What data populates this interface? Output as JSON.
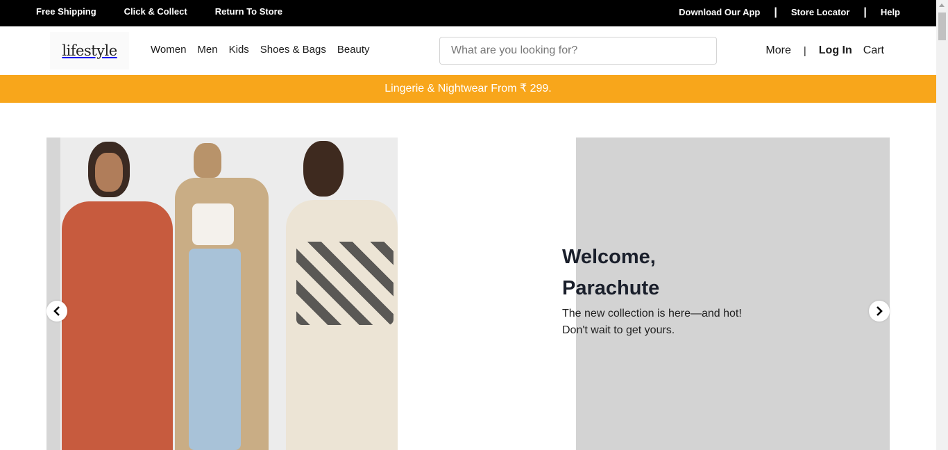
{
  "topbar": {
    "left_links": [
      "Free Shipping",
      "Click & Collect",
      "Return To Store"
    ],
    "download_app": "Download Our App",
    "separator": "|",
    "store_locator": "Store Locator",
    "help": "Help"
  },
  "header": {
    "logo_text": "lifestyle",
    "nav": [
      "Women",
      "Men",
      "Kids",
      "Shoes & Bags",
      "Beauty"
    ],
    "search_placeholder": "What are you looking for?",
    "more": "More",
    "separator": "|",
    "login": "Log In",
    "cart": "Cart"
  },
  "promo": {
    "text": "Lingerie & Nightwear From ₹ 299."
  },
  "hero": {
    "title_line1": "Welcome,",
    "title_line2": "Parachute",
    "subtitle_line1": "The new collection is here—and hot!",
    "subtitle_line2": "Don't wait to get yours."
  },
  "colors": {
    "promo_bg": "#f8a61b",
    "topbar_bg": "#000000",
    "panel_bg": "#d3d3d3"
  }
}
